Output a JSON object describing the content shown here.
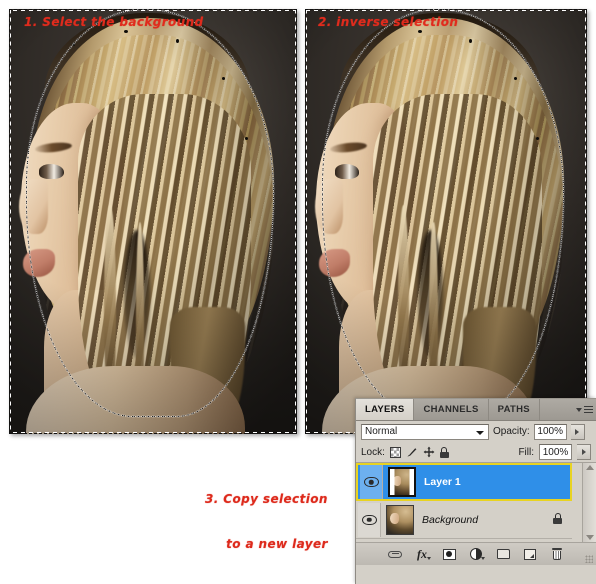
{
  "annotations": {
    "step1": "1. Select the background",
    "step2": "2. inverse selection",
    "step3_line1": "3. Copy selection",
    "step3_line2": "to a new layer",
    "color": "#dd2a1c"
  },
  "panels": {
    "left": {
      "name": "image-panel-select-background"
    },
    "right": {
      "name": "image-panel-inverse-selection"
    }
  },
  "layers_panel": {
    "tabs": [
      {
        "label": "LAYERS",
        "active": true
      },
      {
        "label": "CHANNELS",
        "active": false
      },
      {
        "label": "PATHS",
        "active": false
      }
    ],
    "menu_icon": "panel-menu-icon",
    "blend_mode": "Normal",
    "opacity_label": "Opacity:",
    "opacity_value": "100%",
    "fill_label": "Fill:",
    "fill_value": "100%",
    "lock_label": "Lock:",
    "lock_icons": [
      "lock-transparent-pixels-icon",
      "lock-image-pixels-icon",
      "lock-position-icon",
      "lock-all-icon"
    ],
    "layers": [
      {
        "name": "Layer 1",
        "selected": true,
        "visible": true,
        "locked": false,
        "italic": false
      },
      {
        "name": "Background",
        "selected": false,
        "visible": true,
        "locked": true,
        "italic": true
      }
    ],
    "footer_icons": [
      "link-layers-icon",
      "layer-style-fx-icon",
      "add-layer-mask-icon",
      "new-adjustment-layer-icon",
      "new-group-icon",
      "new-layer-icon",
      "delete-layer-icon"
    ],
    "selection_highlight_color": "#2f8fe8",
    "selection_border_color": "#e8d321"
  }
}
